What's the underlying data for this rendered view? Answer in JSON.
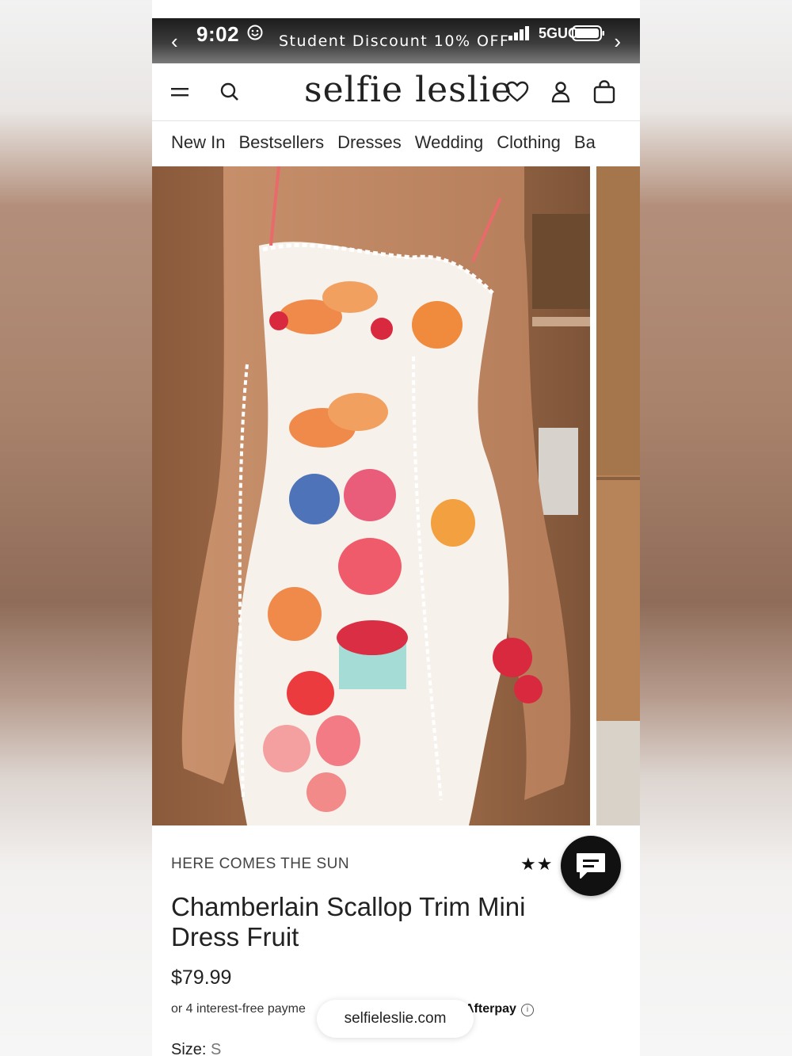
{
  "status_bar": {
    "time": "9:02",
    "network": "5GUC",
    "promo_text": "Student Discount 10% OFF"
  },
  "header": {
    "logo": "selfie leslie"
  },
  "nav": {
    "items": [
      "New In",
      "Bestsellers",
      "Dresses",
      "Wedding",
      "Clothing",
      "Ba"
    ]
  },
  "product": {
    "brand": "HERE COMES THE SUN",
    "stars": "★★",
    "title": "Chamberlain Scallop Trim Mini Dress Fruit",
    "price": "$79.99",
    "installments": "or 4 interest-free payme",
    "afterpay": "Afterpay",
    "size_label": "Size:",
    "size_value": "S"
  },
  "browser": {
    "url": "selfieleslie.com"
  },
  "icons": {
    "menu": "hamburger-menu-icon",
    "search": "search-icon",
    "wishlist": "heart-icon",
    "account": "user-icon",
    "bag": "shopping-bag-icon",
    "chat": "chat-bubble-icon",
    "info": "info-icon"
  }
}
